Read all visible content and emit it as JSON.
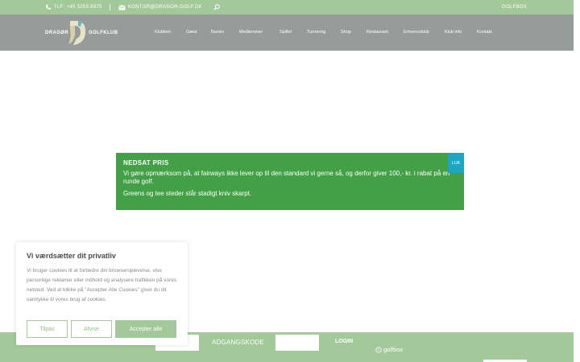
{
  "topbar": {
    "phone": "TLF: +45 3253 8975",
    "email": "KONTOR@DRAGOR-GOLF.DK",
    "golfbox": "GOLFBOX"
  },
  "logo": {
    "left_text": "DRAGØR",
    "right_text": "GOLFKLUB"
  },
  "nav": [
    "Klubben",
    "Gæst",
    "Banen",
    "Medlemmer",
    "Spillet",
    "Turnering",
    "Shop",
    "Restaurant",
    "Erhvervsklub",
    "Klub info",
    "Kontakt"
  ],
  "notice": {
    "title": "NEDSAT PRIS",
    "paragraph1": "Vi gøre opmærksom på, at fairways ikke lever op til den standard vi gerne så, og derfor giver 100,- kr. i rabat på en runde golf.",
    "paragraph2": "Greens og tee steder står stadigt kniv skarpt.",
    "close": "LUK"
  },
  "login": {
    "password_label": "ADGANGSKODE",
    "login_button": "LOGIN",
    "golfbox_brand": "golfbox"
  },
  "cookie": {
    "title": "Vi værdsætter dit privatliv",
    "text": "Vi bruger cookies til at forbedre din browseroplevelse, vise personlige reklamer eller indhold og analysere trafikken på vores netsted. Ved at klikke på \"Accepter Alle Cookies\" giver du dit samtykke til vores brug af cookies.",
    "customize": "Tilpas",
    "reject": "Afvise",
    "accept": "Accepter alle"
  },
  "colors": {
    "accent_green": "#a3c99a",
    "header_gray": "#979c9b",
    "notice_green": "#44a047",
    "close_blue": "#1ba7c4"
  }
}
